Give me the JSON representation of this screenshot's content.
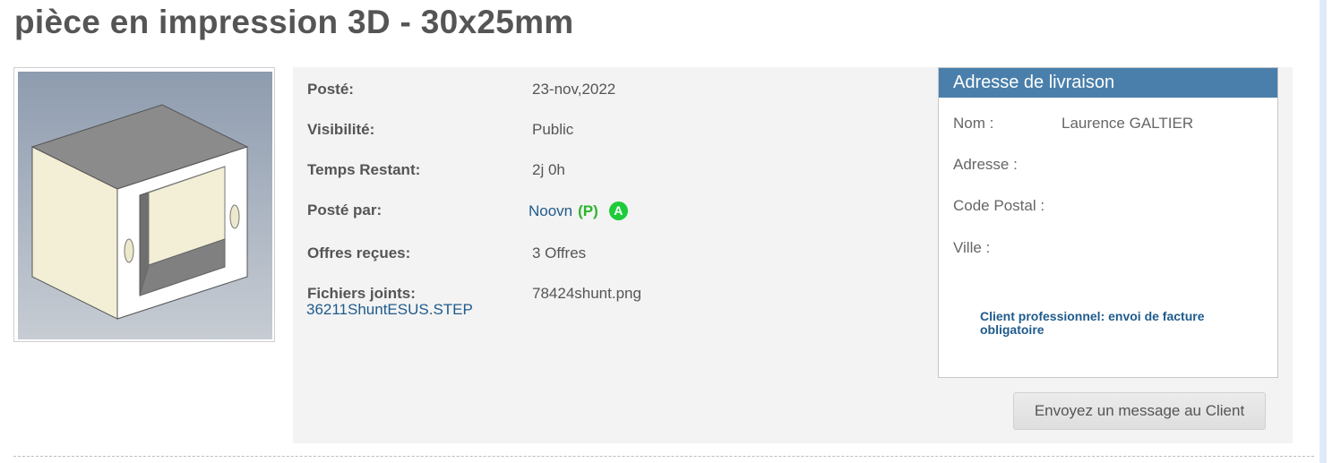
{
  "page": {
    "title": "pièce en impression 3D - 30x25mm"
  },
  "details": {
    "posted_label": "Posté:",
    "posted_value": "23-nov,2022",
    "visibility_label": "Visibilité:",
    "visibility_value": "Public",
    "time_left_label": "Temps Restant:",
    "time_left_value": "2j 0h",
    "posted_by_label": "Posté par:",
    "posted_by_value": "Noovn",
    "posted_by_badge_p": "(P)",
    "posted_by_badge_a": "A",
    "offers_label": "Offres reçues:",
    "offers_value": "3 Offres",
    "files_label": "Fichiers joints:",
    "files": [
      "36211ShuntESUS.STEP",
      "78424shunt.png"
    ]
  },
  "delivery": {
    "header": "Adresse de livraison",
    "name_label": "Nom :",
    "name_value": "Laurence GALTIER",
    "address_label": "Adresse :",
    "postal_label": "Code Postal :",
    "city_label": "Ville :",
    "pro_note": "Client professionnel: envoi de facture obligatoire"
  },
  "actions": {
    "message_button": "Envoyez un message au Client"
  },
  "colors": {
    "accent_header": "#4a7fab",
    "link": "#1f5b8c",
    "badge_green": "#1ecb3a"
  }
}
